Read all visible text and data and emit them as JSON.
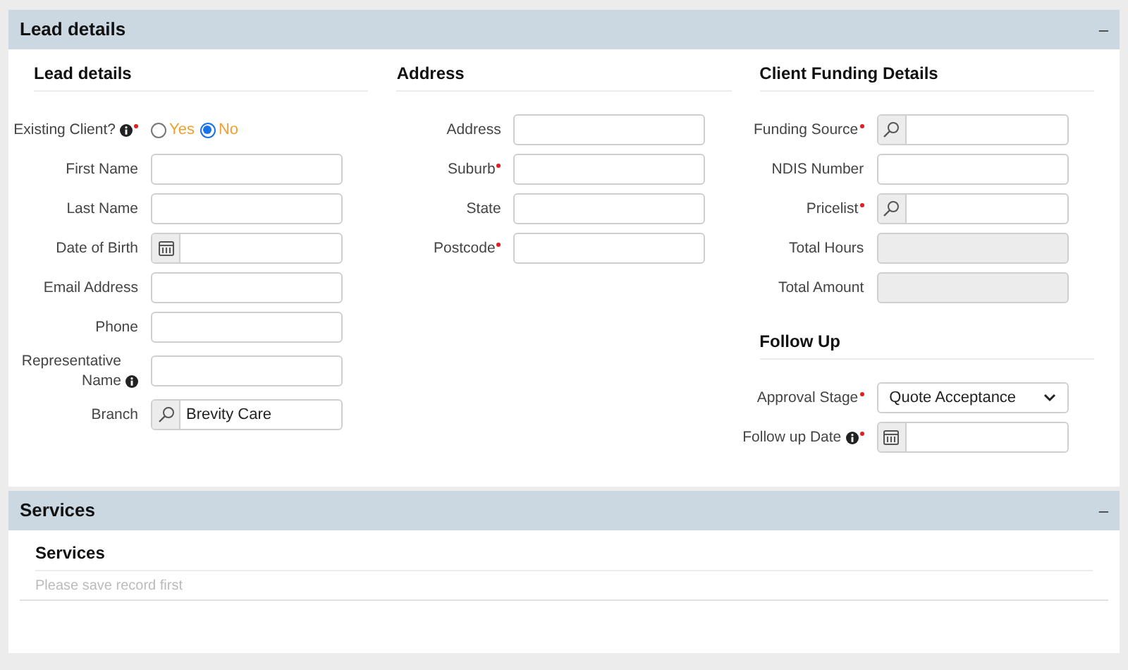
{
  "panels": [
    {
      "title": "Lead details",
      "collapse": "–",
      "expanded": true,
      "columns": [
        {
          "sections": [
            {
              "title": "Lead details",
              "fields": [
                {
                  "kind": "radio",
                  "label": "Existing Client?",
                  "info": true,
                  "required": true,
                  "options": [
                    {
                      "label": "Yes",
                      "selected": false
                    },
                    {
                      "label": "No",
                      "selected": true
                    }
                  ]
                },
                {
                  "kind": "text",
                  "label": "First Name"
                },
                {
                  "kind": "text",
                  "label": "Last Name"
                },
                {
                  "kind": "date",
                  "label": "Date of Birth"
                },
                {
                  "kind": "text",
                  "label": "Email Address"
                },
                {
                  "kind": "text",
                  "label": "Phone"
                },
                {
                  "kind": "text",
                  "label": "Representative Name",
                  "info": true
                },
                {
                  "kind": "lookup",
                  "label": "Branch",
                  "value": "Brevity Care"
                }
              ]
            }
          ]
        },
        {
          "sections": [
            {
              "title": "Address",
              "fields": [
                {
                  "kind": "text",
                  "label": "Address"
                },
                {
                  "kind": "text",
                  "label": "Suburb",
                  "required": true
                },
                {
                  "kind": "text",
                  "label": "State"
                },
                {
                  "kind": "text",
                  "label": "Postcode",
                  "required": true
                }
              ]
            }
          ]
        },
        {
          "sections": [
            {
              "title": "Client Funding Details",
              "fields": [
                {
                  "kind": "lookup",
                  "label": "Funding Source",
                  "required": true
                },
                {
                  "kind": "text",
                  "label": "NDIS Number"
                },
                {
                  "kind": "lookup",
                  "label": "Pricelist",
                  "required": true
                },
                {
                  "kind": "readonly",
                  "label": "Total Hours"
                },
                {
                  "kind": "readonly",
                  "label": "Total Amount"
                }
              ]
            },
            {
              "title": "Follow Up",
              "fields": [
                {
                  "kind": "select",
                  "label": "Approval Stage",
                  "required": true,
                  "value": "Quote Acceptance"
                },
                {
                  "kind": "date",
                  "label": "Follow up Date",
                  "info": true,
                  "required": true
                }
              ]
            }
          ]
        }
      ]
    },
    {
      "title": "Services",
      "collapse": "–",
      "expanded": true,
      "subtitle": "Services",
      "note": "Please save record first"
    }
  ]
}
